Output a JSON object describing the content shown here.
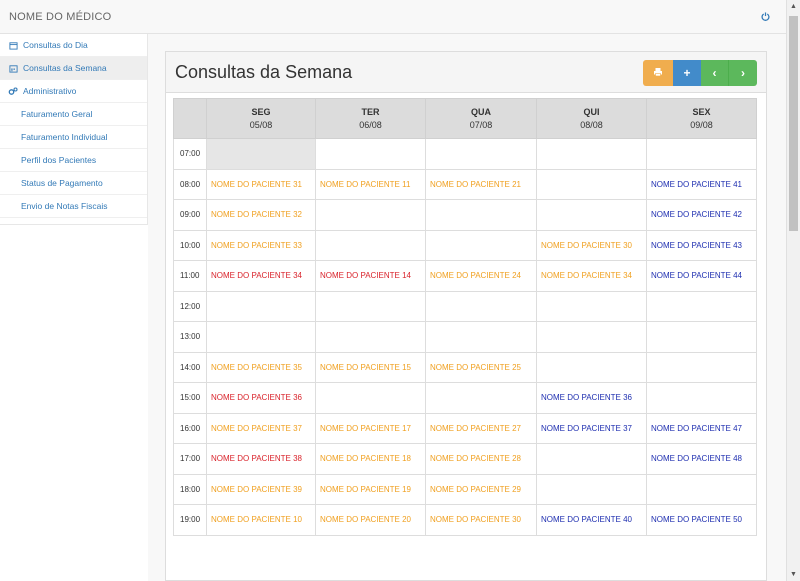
{
  "app": {
    "brand": "NOME DO MÉDICO"
  },
  "sidebar": {
    "items": [
      {
        "label": "Consultas do Dia",
        "icon": "calendar-icon"
      },
      {
        "label": "Consultas da Semana",
        "icon": "calendar-week-icon"
      },
      {
        "label": "Administrativo",
        "icon": "gears-icon"
      },
      {
        "label": "Faturamento Geral"
      },
      {
        "label": "Faturamento Individual"
      },
      {
        "label": "Perfil dos Pacientes"
      },
      {
        "label": "Status de Pagamento"
      },
      {
        "label": "Envio de Notas Fiscais"
      }
    ]
  },
  "panel": {
    "title": "Consultas da Semana",
    "buttons": {
      "print": "print-icon",
      "add": "+",
      "prev": "‹",
      "next": "›"
    }
  },
  "schedule": {
    "days": [
      {
        "name": "SEG",
        "date": "05/08"
      },
      {
        "name": "TER",
        "date": "06/08"
      },
      {
        "name": "QUA",
        "date": "07/08"
      },
      {
        "name": "QUI",
        "date": "08/08"
      },
      {
        "name": "SEX",
        "date": "09/08"
      }
    ],
    "rows": [
      {
        "time": "07:00",
        "cells": [
          {
            "text": "",
            "color": ""
          },
          {
            "text": "",
            "color": ""
          },
          {
            "text": "",
            "color": ""
          },
          {
            "text": "",
            "color": ""
          },
          {
            "text": "",
            "color": ""
          }
        ]
      },
      {
        "time": "08:00",
        "cells": [
          {
            "text": "NOME DO PACIENTE 31",
            "color": "orange"
          },
          {
            "text": "NOME DO PACIENTE 11",
            "color": "orange"
          },
          {
            "text": "NOME DO PACIENTE 21",
            "color": "orange"
          },
          {
            "text": "",
            "color": ""
          },
          {
            "text": "NOME DO PACIENTE 41",
            "color": "blue"
          }
        ]
      },
      {
        "time": "09:00",
        "cells": [
          {
            "text": "NOME DO PACIENTE 32",
            "color": "orange"
          },
          {
            "text": "",
            "color": ""
          },
          {
            "text": "",
            "color": ""
          },
          {
            "text": "",
            "color": ""
          },
          {
            "text": "NOME DO PACIENTE 42",
            "color": "blue"
          }
        ]
      },
      {
        "time": "10:00",
        "cells": [
          {
            "text": "NOME DO PACIENTE 33",
            "color": "orange"
          },
          {
            "text": "",
            "color": ""
          },
          {
            "text": "",
            "color": ""
          },
          {
            "text": "NOME DO PACIENTE 30",
            "color": "orange"
          },
          {
            "text": "NOME DO PACIENTE 43",
            "color": "blue"
          }
        ]
      },
      {
        "time": "11:00",
        "cells": [
          {
            "text": "NOME DO PACIENTE 34",
            "color": "red"
          },
          {
            "text": "NOME DO PACIENTE 14",
            "color": "red"
          },
          {
            "text": "NOME DO PACIENTE 24",
            "color": "orange"
          },
          {
            "text": "NOME DO PACIENTE 34",
            "color": "orange"
          },
          {
            "text": "NOME DO PACIENTE 44",
            "color": "blue"
          }
        ]
      },
      {
        "time": "12:00",
        "cells": [
          {
            "text": "",
            "color": ""
          },
          {
            "text": "",
            "color": ""
          },
          {
            "text": "",
            "color": ""
          },
          {
            "text": "",
            "color": ""
          },
          {
            "text": "",
            "color": ""
          }
        ]
      },
      {
        "time": "13:00",
        "cells": [
          {
            "text": "",
            "color": ""
          },
          {
            "text": "",
            "color": ""
          },
          {
            "text": "",
            "color": ""
          },
          {
            "text": "",
            "color": ""
          },
          {
            "text": "",
            "color": ""
          }
        ]
      },
      {
        "time": "14:00",
        "cells": [
          {
            "text": "NOME DO PACIENTE 35",
            "color": "orange"
          },
          {
            "text": "NOME DO PACIENTE 15",
            "color": "orange"
          },
          {
            "text": "NOME DO PACIENTE 25",
            "color": "orange"
          },
          {
            "text": "",
            "color": ""
          },
          {
            "text": "",
            "color": ""
          }
        ]
      },
      {
        "time": "15:00",
        "cells": [
          {
            "text": "NOME DO PACIENTE 36",
            "color": "red"
          },
          {
            "text": "",
            "color": ""
          },
          {
            "text": "",
            "color": ""
          },
          {
            "text": "NOME DO PACIENTE 36",
            "color": "blue"
          },
          {
            "text": "",
            "color": ""
          }
        ]
      },
      {
        "time": "16:00",
        "cells": [
          {
            "text": "NOME DO PACIENTE 37",
            "color": "orange"
          },
          {
            "text": "NOME DO PACIENTE 17",
            "color": "orange"
          },
          {
            "text": "NOME DO PACIENTE 27",
            "color": "orange"
          },
          {
            "text": "NOME DO PACIENTE 37",
            "color": "blue"
          },
          {
            "text": "NOME DO PACIENTE 47",
            "color": "blue"
          }
        ]
      },
      {
        "time": "17:00",
        "cells": [
          {
            "text": "NOME DO PACIENTE 38",
            "color": "red"
          },
          {
            "text": "NOME DO PACIENTE 18",
            "color": "orange"
          },
          {
            "text": "NOME DO PACIENTE 28",
            "color": "orange"
          },
          {
            "text": "",
            "color": ""
          },
          {
            "text": "NOME DO PACIENTE 48",
            "color": "blue"
          }
        ]
      },
      {
        "time": "18:00",
        "cells": [
          {
            "text": "NOME DO PACIENTE 39",
            "color": "orange"
          },
          {
            "text": "NOME DO PACIENTE 19",
            "color": "orange"
          },
          {
            "text": "NOME DO PACIENTE 29",
            "color": "orange"
          },
          {
            "text": "",
            "color": ""
          },
          {
            "text": "",
            "color": ""
          }
        ]
      },
      {
        "time": "19:00",
        "cells": [
          {
            "text": "NOME DO PACIENTE 10",
            "color": "orange"
          },
          {
            "text": "NOME DO PACIENTE 20",
            "color": "orange"
          },
          {
            "text": "NOME DO PACIENTE 30",
            "color": "orange"
          },
          {
            "text": "NOME DO PACIENTE 40",
            "color": "blue"
          },
          {
            "text": "NOME DO PACIENTE 50",
            "color": "blue"
          }
        ]
      }
    ]
  },
  "colors": {
    "orange": "#f0a020",
    "red": "#d9232b",
    "blue": "#1f2fb0",
    "link": "#337ab7"
  }
}
